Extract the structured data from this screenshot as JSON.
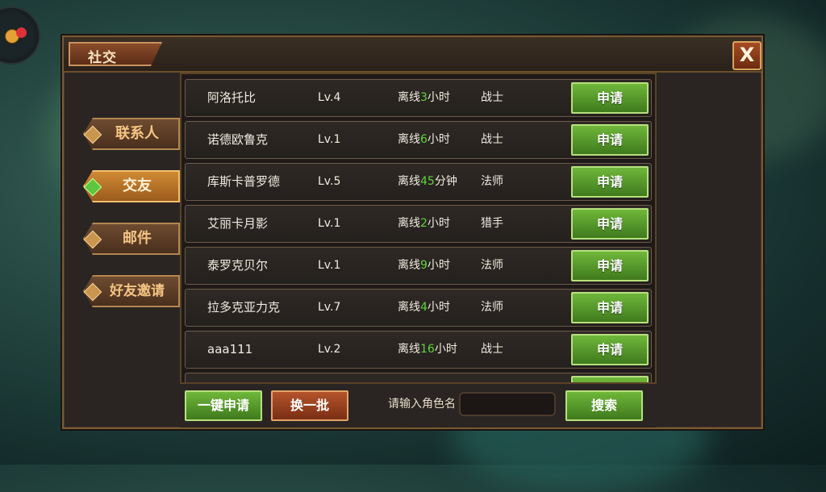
{
  "window": {
    "title": "社交",
    "close_label": "X"
  },
  "sidebar": {
    "items": [
      {
        "label": "联系人",
        "active": false
      },
      {
        "label": "交友",
        "active": true
      },
      {
        "label": "邮件",
        "active": false
      },
      {
        "label": "好友邀请",
        "active": false
      }
    ]
  },
  "players": [
    {
      "name": "阿洛托比",
      "level": "Lv.4",
      "offline_prefix": "离线",
      "offline_value": "3",
      "offline_unit": "小时",
      "class": "战士",
      "action": "申请"
    },
    {
      "name": "诺德欧鲁克",
      "level": "Lv.1",
      "offline_prefix": "离线",
      "offline_value": "6",
      "offline_unit": "小时",
      "class": "战士",
      "action": "申请"
    },
    {
      "name": "库斯卡普罗德",
      "level": "Lv.5",
      "offline_prefix": "离线",
      "offline_value": "45",
      "offline_unit": "分钟",
      "class": "法师",
      "action": "申请"
    },
    {
      "name": "艾丽卡月影",
      "level": "Lv.1",
      "offline_prefix": "离线",
      "offline_value": "2",
      "offline_unit": "小时",
      "class": "猎手",
      "action": "申请"
    },
    {
      "name": "泰罗克贝尔",
      "level": "Lv.1",
      "offline_prefix": "离线",
      "offline_value": "9",
      "offline_unit": "小时",
      "class": "法师",
      "action": "申请"
    },
    {
      "name": "拉多克亚力克",
      "level": "Lv.7",
      "offline_prefix": "离线",
      "offline_value": "4",
      "offline_unit": "小时",
      "class": "法师",
      "action": "申请"
    },
    {
      "name": "aaa111",
      "level": "Lv.2",
      "offline_prefix": "离线",
      "offline_value": "16",
      "offline_unit": "小时",
      "class": "战士",
      "action": "申请"
    }
  ],
  "bottom": {
    "apply_all": "一键申请",
    "refresh": "换一批",
    "search_label": "请输入角色名",
    "search_value": "",
    "search_button": "搜索"
  },
  "colors": {
    "highlight_green": "#5fd43b",
    "button_green": "#4f9a28",
    "button_red": "#9b3f1e",
    "panel_bg": "#2a2523",
    "frame_gold": "#b38750"
  }
}
